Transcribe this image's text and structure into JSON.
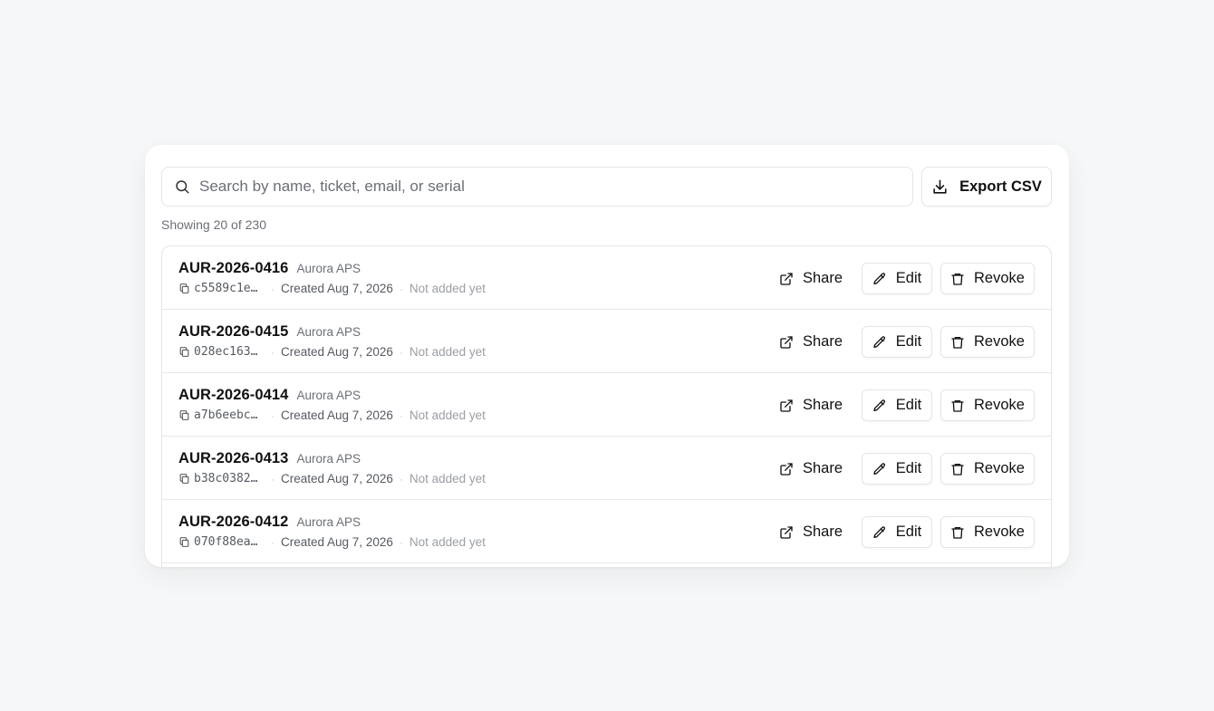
{
  "search": {
    "placeholder": "Search by name, ticket, email, or serial"
  },
  "toolbar": {
    "export_label": "Export CSV"
  },
  "count_text": "Showing 20 of 230",
  "actions": {
    "share": "Share",
    "edit": "Edit",
    "revoke": "Revoke"
  },
  "rows": [
    {
      "ticket": "AUR-2026-0416",
      "org": "Aurora APS",
      "serial": "c5589c1e…",
      "created": "Created Aug 7, 2026",
      "status": "Not added yet"
    },
    {
      "ticket": "AUR-2026-0415",
      "org": "Aurora APS",
      "serial": "028ec163…",
      "created": "Created Aug 7, 2026",
      "status": "Not added yet"
    },
    {
      "ticket": "AUR-2026-0414",
      "org": "Aurora APS",
      "serial": "a7b6eebc…",
      "created": "Created Aug 7, 2026",
      "status": "Not added yet"
    },
    {
      "ticket": "AUR-2026-0413",
      "org": "Aurora APS",
      "serial": "b38c0382…",
      "created": "Created Aug 7, 2026",
      "status": "Not added yet"
    },
    {
      "ticket": "AUR-2026-0412",
      "org": "Aurora APS",
      "serial": "070f88ea…",
      "created": "Created Aug 7, 2026",
      "status": "Not added yet"
    }
  ]
}
